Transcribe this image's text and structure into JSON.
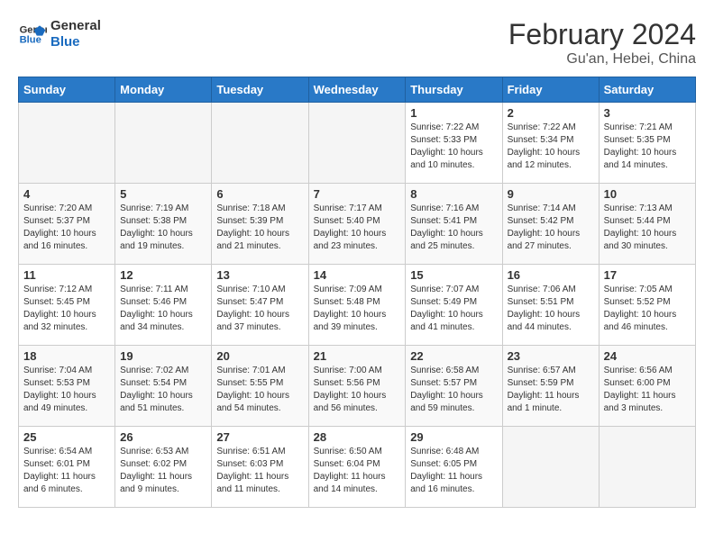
{
  "logo": {
    "line1": "General",
    "line2": "Blue"
  },
  "title": "February 2024",
  "subtitle": "Gu'an, Hebei, China",
  "headers": [
    "Sunday",
    "Monday",
    "Tuesday",
    "Wednesday",
    "Thursday",
    "Friday",
    "Saturday"
  ],
  "weeks": [
    [
      {
        "day": "",
        "detail": ""
      },
      {
        "day": "",
        "detail": ""
      },
      {
        "day": "",
        "detail": ""
      },
      {
        "day": "",
        "detail": ""
      },
      {
        "day": "1",
        "detail": "Sunrise: 7:22 AM\nSunset: 5:33 PM\nDaylight: 10 hours\nand 10 minutes."
      },
      {
        "day": "2",
        "detail": "Sunrise: 7:22 AM\nSunset: 5:34 PM\nDaylight: 10 hours\nand 12 minutes."
      },
      {
        "day": "3",
        "detail": "Sunrise: 7:21 AM\nSunset: 5:35 PM\nDaylight: 10 hours\nand 14 minutes."
      }
    ],
    [
      {
        "day": "4",
        "detail": "Sunrise: 7:20 AM\nSunset: 5:37 PM\nDaylight: 10 hours\nand 16 minutes."
      },
      {
        "day": "5",
        "detail": "Sunrise: 7:19 AM\nSunset: 5:38 PM\nDaylight: 10 hours\nand 19 minutes."
      },
      {
        "day": "6",
        "detail": "Sunrise: 7:18 AM\nSunset: 5:39 PM\nDaylight: 10 hours\nand 21 minutes."
      },
      {
        "day": "7",
        "detail": "Sunrise: 7:17 AM\nSunset: 5:40 PM\nDaylight: 10 hours\nand 23 minutes."
      },
      {
        "day": "8",
        "detail": "Sunrise: 7:16 AM\nSunset: 5:41 PM\nDaylight: 10 hours\nand 25 minutes."
      },
      {
        "day": "9",
        "detail": "Sunrise: 7:14 AM\nSunset: 5:42 PM\nDaylight: 10 hours\nand 27 minutes."
      },
      {
        "day": "10",
        "detail": "Sunrise: 7:13 AM\nSunset: 5:44 PM\nDaylight: 10 hours\nand 30 minutes."
      }
    ],
    [
      {
        "day": "11",
        "detail": "Sunrise: 7:12 AM\nSunset: 5:45 PM\nDaylight: 10 hours\nand 32 minutes."
      },
      {
        "day": "12",
        "detail": "Sunrise: 7:11 AM\nSunset: 5:46 PM\nDaylight: 10 hours\nand 34 minutes."
      },
      {
        "day": "13",
        "detail": "Sunrise: 7:10 AM\nSunset: 5:47 PM\nDaylight: 10 hours\nand 37 minutes."
      },
      {
        "day": "14",
        "detail": "Sunrise: 7:09 AM\nSunset: 5:48 PM\nDaylight: 10 hours\nand 39 minutes."
      },
      {
        "day": "15",
        "detail": "Sunrise: 7:07 AM\nSunset: 5:49 PM\nDaylight: 10 hours\nand 41 minutes."
      },
      {
        "day": "16",
        "detail": "Sunrise: 7:06 AM\nSunset: 5:51 PM\nDaylight: 10 hours\nand 44 minutes."
      },
      {
        "day": "17",
        "detail": "Sunrise: 7:05 AM\nSunset: 5:52 PM\nDaylight: 10 hours\nand 46 minutes."
      }
    ],
    [
      {
        "day": "18",
        "detail": "Sunrise: 7:04 AM\nSunset: 5:53 PM\nDaylight: 10 hours\nand 49 minutes."
      },
      {
        "day": "19",
        "detail": "Sunrise: 7:02 AM\nSunset: 5:54 PM\nDaylight: 10 hours\nand 51 minutes."
      },
      {
        "day": "20",
        "detail": "Sunrise: 7:01 AM\nSunset: 5:55 PM\nDaylight: 10 hours\nand 54 minutes."
      },
      {
        "day": "21",
        "detail": "Sunrise: 7:00 AM\nSunset: 5:56 PM\nDaylight: 10 hours\nand 56 minutes."
      },
      {
        "day": "22",
        "detail": "Sunrise: 6:58 AM\nSunset: 5:57 PM\nDaylight: 10 hours\nand 59 minutes."
      },
      {
        "day": "23",
        "detail": "Sunrise: 6:57 AM\nSunset: 5:59 PM\nDaylight: 11 hours\nand 1 minute."
      },
      {
        "day": "24",
        "detail": "Sunrise: 6:56 AM\nSunset: 6:00 PM\nDaylight: 11 hours\nand 3 minutes."
      }
    ],
    [
      {
        "day": "25",
        "detail": "Sunrise: 6:54 AM\nSunset: 6:01 PM\nDaylight: 11 hours\nand 6 minutes."
      },
      {
        "day": "26",
        "detail": "Sunrise: 6:53 AM\nSunset: 6:02 PM\nDaylight: 11 hours\nand 9 minutes."
      },
      {
        "day": "27",
        "detail": "Sunrise: 6:51 AM\nSunset: 6:03 PM\nDaylight: 11 hours\nand 11 minutes."
      },
      {
        "day": "28",
        "detail": "Sunrise: 6:50 AM\nSunset: 6:04 PM\nDaylight: 11 hours\nand 14 minutes."
      },
      {
        "day": "29",
        "detail": "Sunrise: 6:48 AM\nSunset: 6:05 PM\nDaylight: 11 hours\nand 16 minutes."
      },
      {
        "day": "",
        "detail": ""
      },
      {
        "day": "",
        "detail": ""
      }
    ]
  ]
}
